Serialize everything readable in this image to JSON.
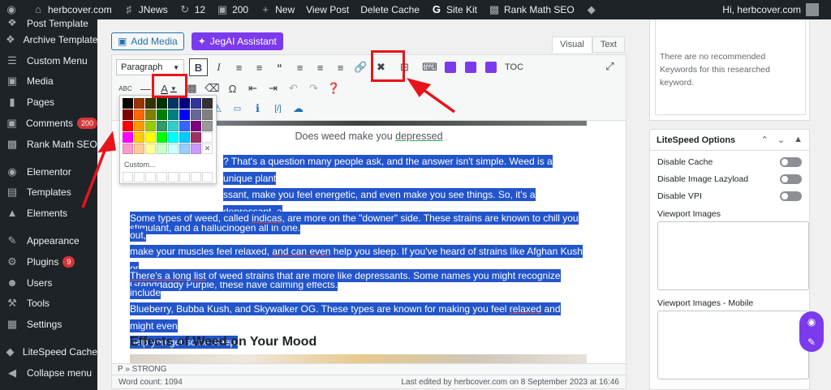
{
  "adminbar": {
    "wp_logo": "wordpress-icon",
    "site": "herbcover.com",
    "jnews": "JNews",
    "updates": "12",
    "comments": "200",
    "new": "New",
    "view_post": "View Post",
    "delete_cache": "Delete Cache",
    "site_kit": "Site Kit",
    "rank_math": "Rank Math SEO",
    "greeting": "Hi, herbcover.com"
  },
  "sidebar": {
    "items": [
      {
        "label": "Post Template",
        "icon": "dashicon-template"
      },
      {
        "label": "Archive Template",
        "icon": "dashicon-template"
      },
      {
        "label": "Custom Menu",
        "icon": "dashicon-menu"
      },
      {
        "label": "Media",
        "icon": "dashicon-media"
      },
      {
        "label": "Pages",
        "icon": "dashicon-page"
      },
      {
        "label": "Comments",
        "icon": "dashicon-comments",
        "badge": "200"
      },
      {
        "label": "Rank Math SEO",
        "icon": "dashicon-chart"
      },
      {
        "label": "Elementor",
        "icon": "elementor-icon"
      },
      {
        "label": "Templates",
        "icon": "dashicon-folder"
      },
      {
        "label": "Elements",
        "icon": "dashicon-elements"
      },
      {
        "label": "Appearance",
        "icon": "dashicon-brush"
      },
      {
        "label": "Plugins",
        "icon": "dashicon-plugin",
        "badge": "9"
      },
      {
        "label": "Users",
        "icon": "dashicon-users"
      },
      {
        "label": "Tools",
        "icon": "dashicon-tools"
      },
      {
        "label": "Settings",
        "icon": "dashicon-settings"
      },
      {
        "label": "LiteSpeed Cache",
        "icon": "litespeed-icon"
      },
      {
        "label": "Collapse menu",
        "icon": "collapse-icon"
      }
    ]
  },
  "editor": {
    "add_media": "Add Media",
    "jegai": "JegAI Assistant",
    "tab_visual": "Visual",
    "tab_text": "Text",
    "format_select": "Paragraph",
    "toc": "TOC",
    "caption_prefix": "Does weed make you ",
    "caption_link": "depressed",
    "para1": "? That's a question many people ask, and the answer isn't simple. Weed is a unique plant",
    "para1b": "ssant, make you feel energetic, and even make you see things. So, it's a depressant, a",
    "para1c": "stimulant, and a hallucinogen all in one.",
    "para2a": "Some types of weed, called ",
    "para2_link": "indicas",
    "para2b": ", are more on the \"downer\" side. These strains are known to chill you out,",
    "para2c": "make your muscles feel relaxed, ",
    "para2_link2": "and can even",
    "para2d": " help you sleep. If you've heard of strains like Afghan Kush or",
    "para2e": "Granddaddy Purple, these have calming effects.",
    "para3_link": "There's a long list",
    "para3a": " of weed strains that are more like depressants. Some names you might recognize include",
    "para3b": "Blueberry, Bubba Kush, and Skywalker OG. These types are known for making you feel ",
    "para3_link2": "relaxed",
    "para3c": " and might even",
    "para3d": "help you get some sleep.",
    "heading": "Effects of Weed on Your Mood",
    "path": "P » STRONG",
    "word_count": "Word count: 1094",
    "last_edited": "Last edited by herbcover.com on 8 September 2023 at 16:46"
  },
  "picker": {
    "custom": "Custom...",
    "colors": [
      "#000000",
      "#993300",
      "#333300",
      "#003300",
      "#003366",
      "#000080",
      "#333399",
      "#333333",
      "#800000",
      "#ff6600",
      "#808000",
      "#008000",
      "#008080",
      "#0000ff",
      "#666699",
      "#808080",
      "#ff0000",
      "#ff9900",
      "#99cc00",
      "#339966",
      "#33cccc",
      "#3366ff",
      "#800080",
      "#999999",
      "#ff00ff",
      "#ffcc00",
      "#ffff00",
      "#00ff00",
      "#00ffff",
      "#00ccff",
      "#993366",
      "#ffffff",
      "#ff99cc",
      "#ffcc99",
      "#ffff99",
      "#ccffcc",
      "#ccffff",
      "#99ccff",
      "#cc99ff"
    ]
  },
  "right_panel": {
    "no_keywords": "There are no recommended Keywords for this researched keyword.",
    "ls_title": "LiteSpeed Options",
    "disable_cache": "Disable Cache",
    "disable_lazyload": "Disable Image Lazyload",
    "disable_vpi": "Disable VPI",
    "viewport_images": "Viewport Images",
    "viewport_images_mobile": "Viewport Images - Mobile"
  },
  "colors": {
    "selection": "#2255cc",
    "annotation_red": "#e8141b",
    "accent_purple": "#7c3aed"
  }
}
